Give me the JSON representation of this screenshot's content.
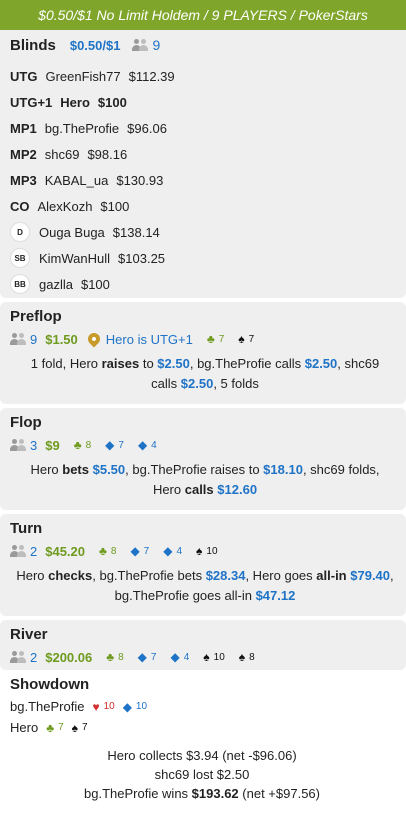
{
  "header": {
    "title": "$0.50/$1 No Limit Holdem / 9 PLAYERS / PokerStars"
  },
  "blinds": {
    "title": "Blinds",
    "stakes": "$0.50/$1",
    "players": "9",
    "seats": [
      {
        "pos": "UTG",
        "name": "GreenFish77",
        "stack": "$112.39",
        "bold": false
      },
      {
        "pos": "UTG+1",
        "name": "Hero",
        "stack": "$100",
        "bold": true
      },
      {
        "pos": "MP1",
        "name": "bg.TheProfie",
        "stack": "$96.06",
        "bold": false
      },
      {
        "pos": "MP2",
        "name": "shc69",
        "stack": "$98.16",
        "bold": false
      },
      {
        "pos": "MP3",
        "name": "KABAL_ua",
        "stack": "$130.93",
        "bold": false
      },
      {
        "pos": "CO",
        "name": "AlexKozh",
        "stack": "$100",
        "bold": false
      },
      {
        "badge": "D",
        "name": "Ouga Buga",
        "stack": "$138.14"
      },
      {
        "badge": "SB",
        "name": "KimWanHull",
        "stack": "$103.25"
      },
      {
        "badge": "BB",
        "name": "gazlla",
        "stack": "$100"
      }
    ]
  },
  "preflop": {
    "title": "Preflop",
    "players": "9",
    "pot": "$1.50",
    "hero_pos": "Hero is UTG+1",
    "hole": [
      {
        "rank": "7",
        "suit": "club"
      },
      {
        "rank": "7",
        "suit": "spade"
      }
    ],
    "action": [
      {
        "t": "1 fold, Hero "
      },
      {
        "t": "raises",
        "b": true
      },
      {
        "t": " to "
      },
      {
        "t": "$2.50",
        "a": true
      },
      {
        "t": ", bg.TheProfie calls "
      },
      {
        "t": "$2.50",
        "a": true
      },
      {
        "t": ", shc69 calls "
      },
      {
        "t": "$2.50",
        "a": true
      },
      {
        "t": ", 5 folds"
      }
    ]
  },
  "flop": {
    "title": "Flop",
    "players": "3",
    "pot": "$9",
    "cards": [
      {
        "rank": "8",
        "suit": "club"
      },
      {
        "rank": "7",
        "suit": "diamond"
      },
      {
        "rank": "4",
        "suit": "diamond"
      }
    ],
    "action": [
      {
        "t": "Hero "
      },
      {
        "t": "bets",
        "b": true
      },
      {
        "t": " "
      },
      {
        "t": "$5.50",
        "a": true
      },
      {
        "t": ", bg.TheProfie raises to "
      },
      {
        "t": "$18.10",
        "a": true
      },
      {
        "t": ", shc69 folds, Hero "
      },
      {
        "t": "calls",
        "b": true
      },
      {
        "t": " "
      },
      {
        "t": "$12.60",
        "a": true
      }
    ]
  },
  "turn": {
    "title": "Turn",
    "players": "2",
    "pot": "$45.20",
    "cards": [
      {
        "rank": "8",
        "suit": "club"
      },
      {
        "rank": "7",
        "suit": "diamond"
      },
      {
        "rank": "4",
        "suit": "diamond"
      },
      {
        "rank": "10",
        "suit": "spade"
      }
    ],
    "action": [
      {
        "t": "Hero "
      },
      {
        "t": "checks",
        "b": true
      },
      {
        "t": ", bg.TheProfie bets "
      },
      {
        "t": "$28.34",
        "a": true
      },
      {
        "t": ", Hero goes "
      },
      {
        "t": "all-in",
        "b": true
      },
      {
        "t": " "
      },
      {
        "t": "$79.40",
        "a": true
      },
      {
        "t": ", bg.TheProfie goes all-in "
      },
      {
        "t": "$47.12",
        "a": true
      }
    ]
  },
  "river": {
    "title": "River",
    "players": "2",
    "pot": "$200.06",
    "cards": [
      {
        "rank": "8",
        "suit": "club"
      },
      {
        "rank": "7",
        "suit": "diamond"
      },
      {
        "rank": "4",
        "suit": "diamond"
      },
      {
        "rank": "10",
        "suit": "spade"
      },
      {
        "rank": "8",
        "suit": "spade"
      }
    ]
  },
  "showdown": {
    "title": "Showdown",
    "hands": [
      {
        "name": "bg.TheProfie",
        "cards": [
          {
            "rank": "10",
            "suit": "heart"
          },
          {
            "rank": "10",
            "suit": "diamond"
          }
        ]
      },
      {
        "name": "Hero",
        "cards": [
          {
            "rank": "7",
            "suit": "club"
          },
          {
            "rank": "7",
            "suit": "spade"
          }
        ]
      }
    ],
    "results": [
      [
        {
          "t": "Hero collects $3.94 (net -$96.06)"
        }
      ],
      [
        {
          "t": "shc69 lost $2.50"
        }
      ],
      [
        {
          "t": "bg.TheProfie wins "
        },
        {
          "t": "$193.62",
          "b": true
        },
        {
          "t": "  (net +$97.56)"
        }
      ]
    ]
  },
  "colors": {
    "header": "#7fa62a",
    "accent_blue": "#1e73c7",
    "accent_green": "#6e9a1e",
    "panel": "#efefef"
  },
  "icons": {
    "players": "people-icon",
    "position": "map-pin-icon",
    "club": "club-suit-icon",
    "diamond": "diamond-suit-icon",
    "spade": "spade-suit-icon",
    "heart": "heart-suit-icon"
  }
}
